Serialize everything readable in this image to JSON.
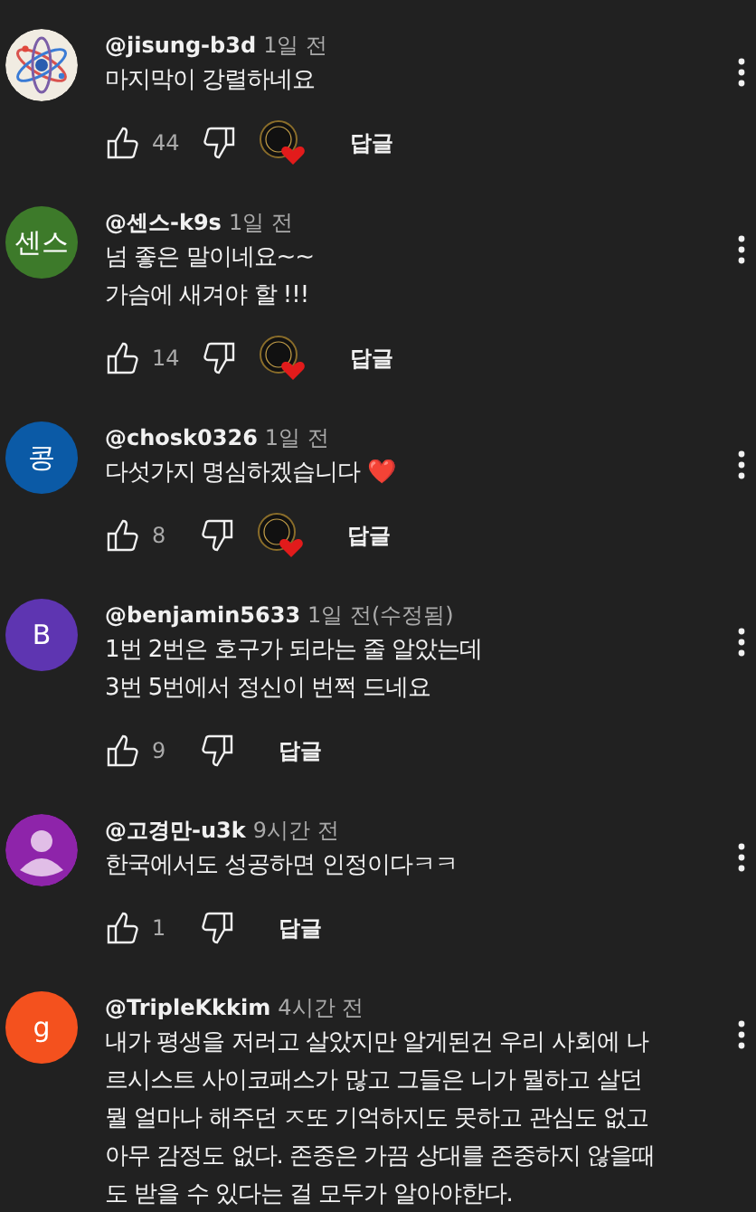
{
  "comments": [
    {
      "avatar": {
        "kind": "atom"
      },
      "author": "@jisung-b3d",
      "time": "1일 전",
      "text": "마지막이 강렬하네요",
      "likes": "44",
      "creator_heart": true,
      "reply": "답글"
    },
    {
      "avatar": {
        "kind": "letter",
        "letter": "센스",
        "color": "#3d7a2a"
      },
      "author": "@센스-k9s",
      "time": "1일 전",
      "text": "넘 좋은 말이네요~~\n가슴에 새겨야 할 !!!",
      "likes": "14",
      "creator_heart": true,
      "reply": "답글"
    },
    {
      "avatar": {
        "kind": "letter",
        "letter": "콩",
        "color": "#0b5aa6"
      },
      "author": "@chosk0326",
      "time": "1일 전",
      "text": "다섯가지 명심하겠습니다 ❤️",
      "likes": "8",
      "creator_heart": true,
      "reply": "답글"
    },
    {
      "avatar": {
        "kind": "letter",
        "letter": "B",
        "color": "#5e35b1"
      },
      "author": "@benjamin5633",
      "time": "1일 전",
      "edited": "(수정됨)",
      "text": "1번 2번은 호구가 되라는 줄 알았는데\n3번 5번에서 정신이 번쩍 드네요",
      "likes": "9",
      "creator_heart": false,
      "reply": "답글"
    },
    {
      "avatar": {
        "kind": "silhouette",
        "color": "#8e24aa"
      },
      "author": "@고경만-u3k",
      "time": "9시간 전",
      "text": "한국에서도 성공하면 인정이다ㅋㅋ",
      "likes": "1",
      "creator_heart": false,
      "reply": "답글"
    },
    {
      "avatar": {
        "kind": "letter",
        "letter": "g",
        "color": "#f4511e"
      },
      "author": "@TripleKkkim",
      "time": "4시간 전",
      "text": "내가 평생을 저러고 살았지만 알게된건 우리 사회에 나르시스트 사이코패스가 많고 그들은 니가 뭘하고 살던 뭘 얼마나 해주던 ㅈ또 기억하지도 못하고 관심도 없고 아무 감정도 없다. 존중은 가끔 상대를 존중하지 않을때도 받을 수 있다는 걸 모두가 알아야한다."
    }
  ]
}
